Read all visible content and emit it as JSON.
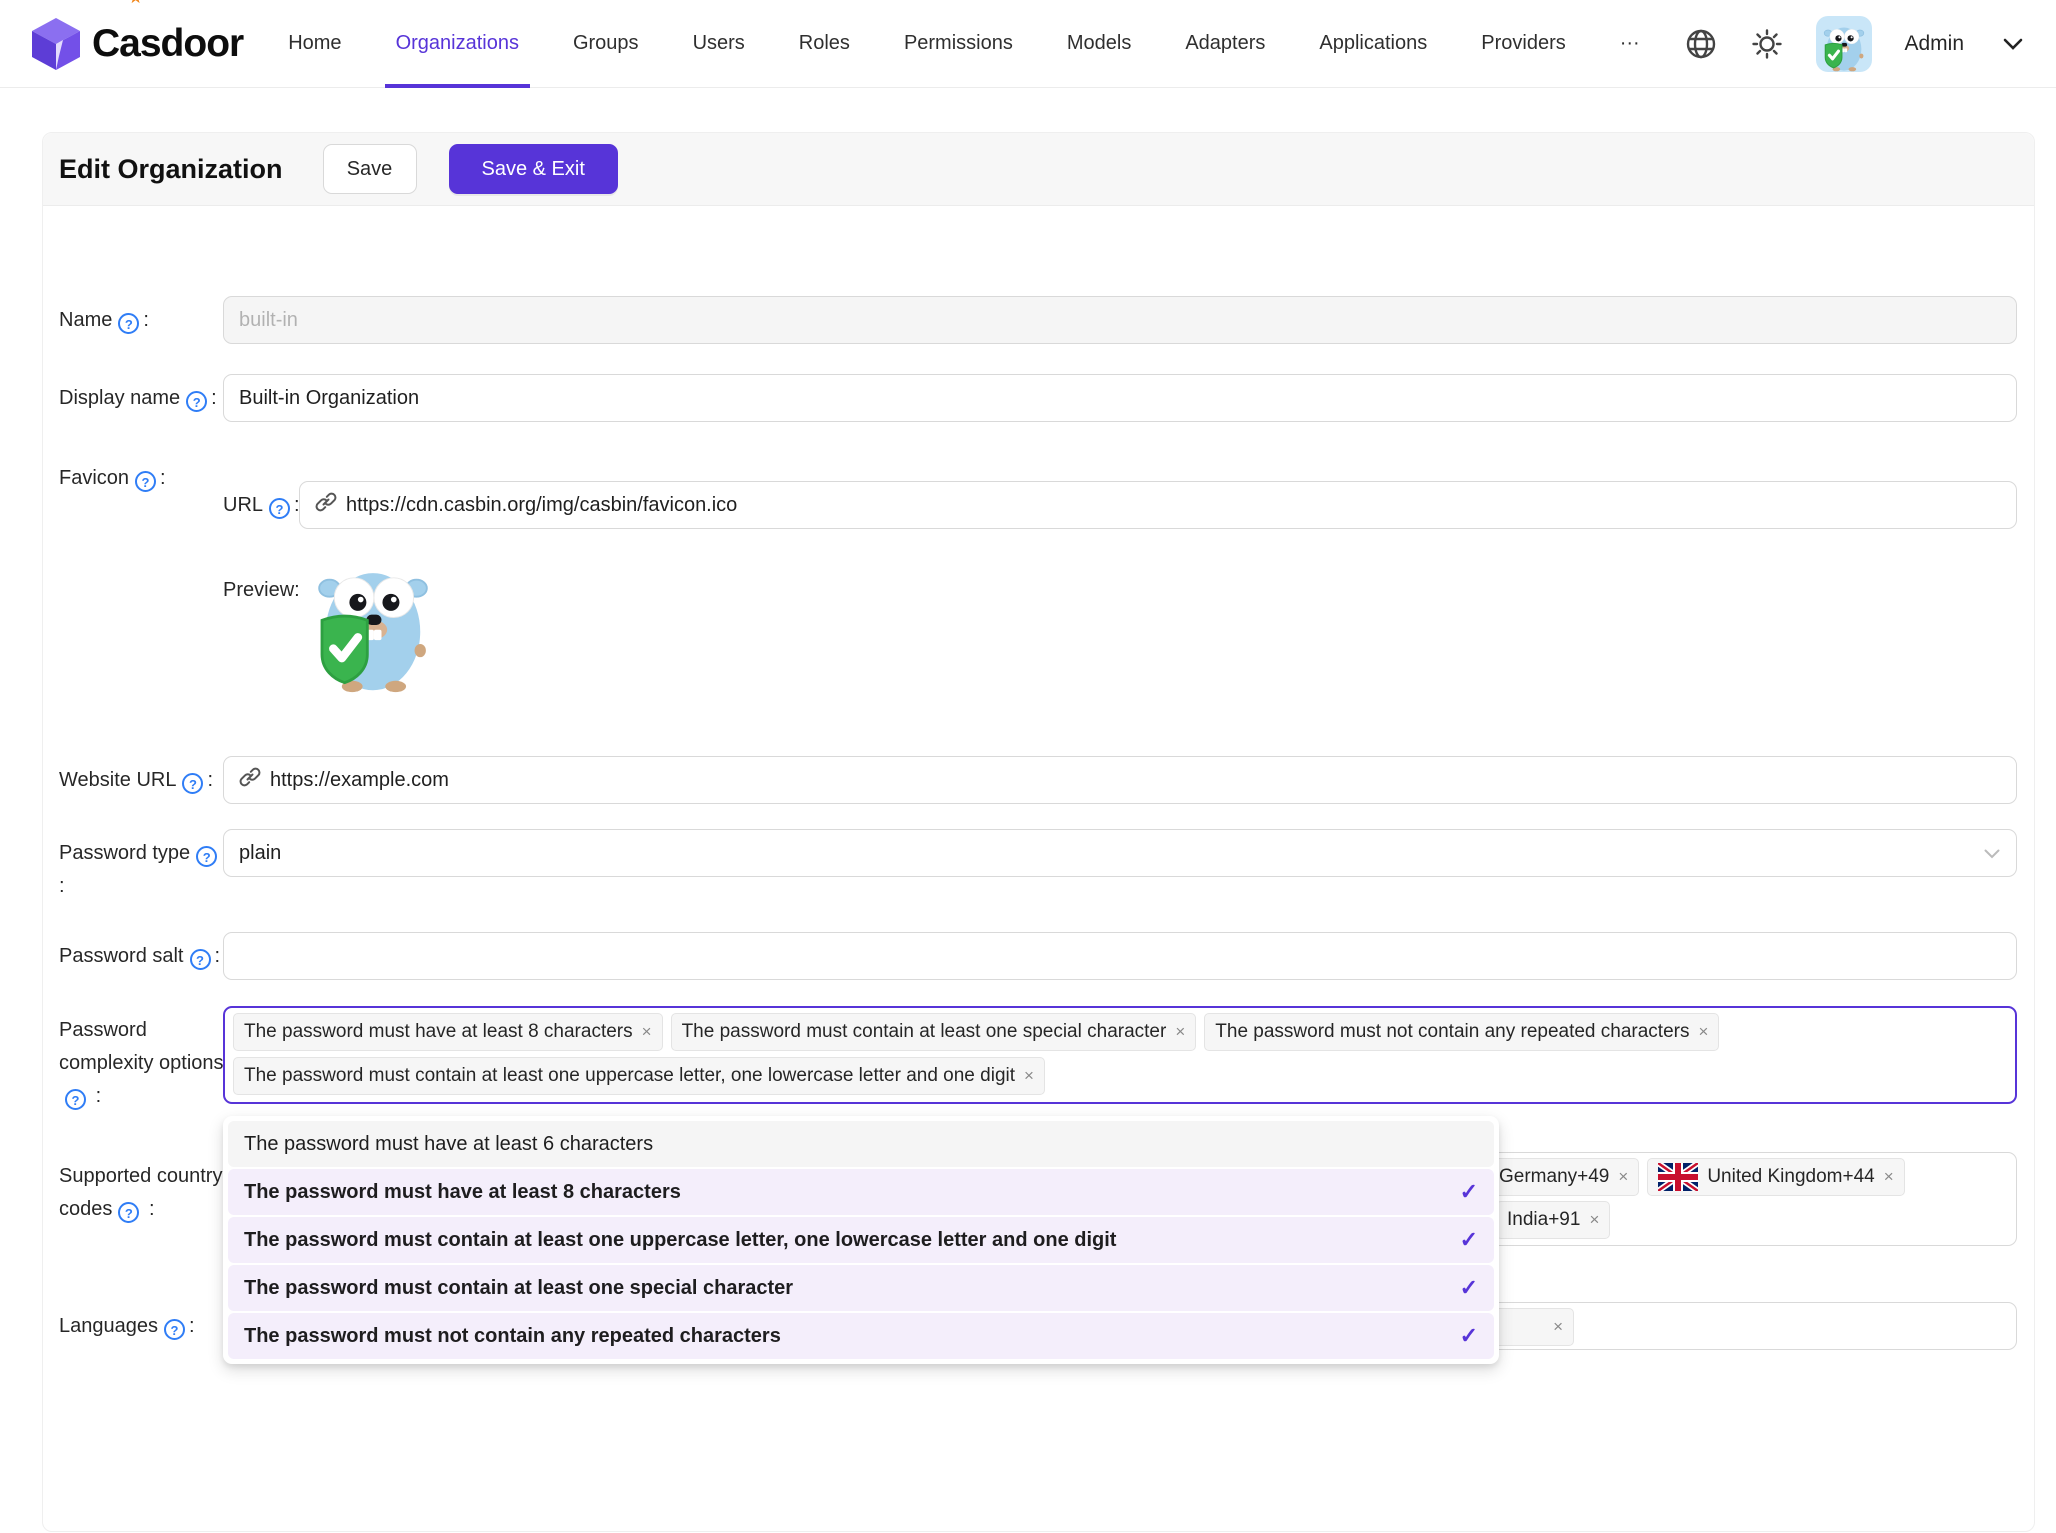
{
  "ui": {
    "colon": ":",
    "close_x": "×",
    "check": "✓",
    "help": "?"
  },
  "colors": {
    "accent": "#5734d8",
    "help_blue": "#2f7df6",
    "selected_option_bg": "#f4eefb"
  },
  "navbar": {
    "brand": "Casdoor",
    "items": [
      {
        "label": "Home",
        "active": false
      },
      {
        "label": "Organizations",
        "active": true
      },
      {
        "label": "Groups",
        "active": false
      },
      {
        "label": "Users",
        "active": false
      },
      {
        "label": "Roles",
        "active": false
      },
      {
        "label": "Permissions",
        "active": false
      },
      {
        "label": "Models",
        "active": false
      },
      {
        "label": "Adapters",
        "active": false
      },
      {
        "label": "Applications",
        "active": false
      },
      {
        "label": "Providers",
        "active": false
      },
      {
        "label": "···",
        "active": false
      }
    ],
    "user": "Admin"
  },
  "header": {
    "title": "Edit Organization",
    "save": "Save",
    "save_exit": "Save & Exit"
  },
  "form": {
    "name": {
      "label": "Name",
      "value": "built-in"
    },
    "display_name": {
      "label": "Display name",
      "value": "Built-in Organization"
    },
    "favicon": {
      "label": "Favicon",
      "url_label": "URL",
      "url": "https://cdn.casbin.org/img/casbin/favicon.ico",
      "preview_label": "Preview:"
    },
    "website_url": {
      "label": "Website URL",
      "value": "https://example.com"
    },
    "password_type": {
      "label": "Password type",
      "value": "plain"
    },
    "password_salt": {
      "label": "Password salt",
      "value": ""
    },
    "password_complexity": {
      "label_line1": "Password",
      "label_line2": "complexity",
      "label_line3": "options",
      "tags": [
        "The password must have at least 8 characters",
        "The password must contain at least one special character",
        "The password must not contain any repeated characters",
        "The password must contain at least one uppercase letter, one lowercase letter and one digit"
      ]
    },
    "country_codes": {
      "label_line1": "Supported",
      "label_line2": "country codes",
      "tags": [
        {
          "label": "Germany+49",
          "flag": "de"
        },
        {
          "label": "United Kingdom+44",
          "flag": "gb"
        },
        {
          "label": "India+91",
          "flag": ""
        }
      ]
    },
    "languages": {
      "label": "Languages",
      "partial_tag_close": "×"
    }
  },
  "dropdown": {
    "options": [
      {
        "label": "The password must have at least 6 characters",
        "selected": false
      },
      {
        "label": "The password must have at least 8 characters",
        "selected": true
      },
      {
        "label": "The password must contain at least one uppercase letter, one lowercase letter and one digit",
        "selected": true
      },
      {
        "label": "The password must contain at least one special character",
        "selected": true
      },
      {
        "label": "The password must not contain any repeated characters",
        "selected": true
      }
    ]
  }
}
